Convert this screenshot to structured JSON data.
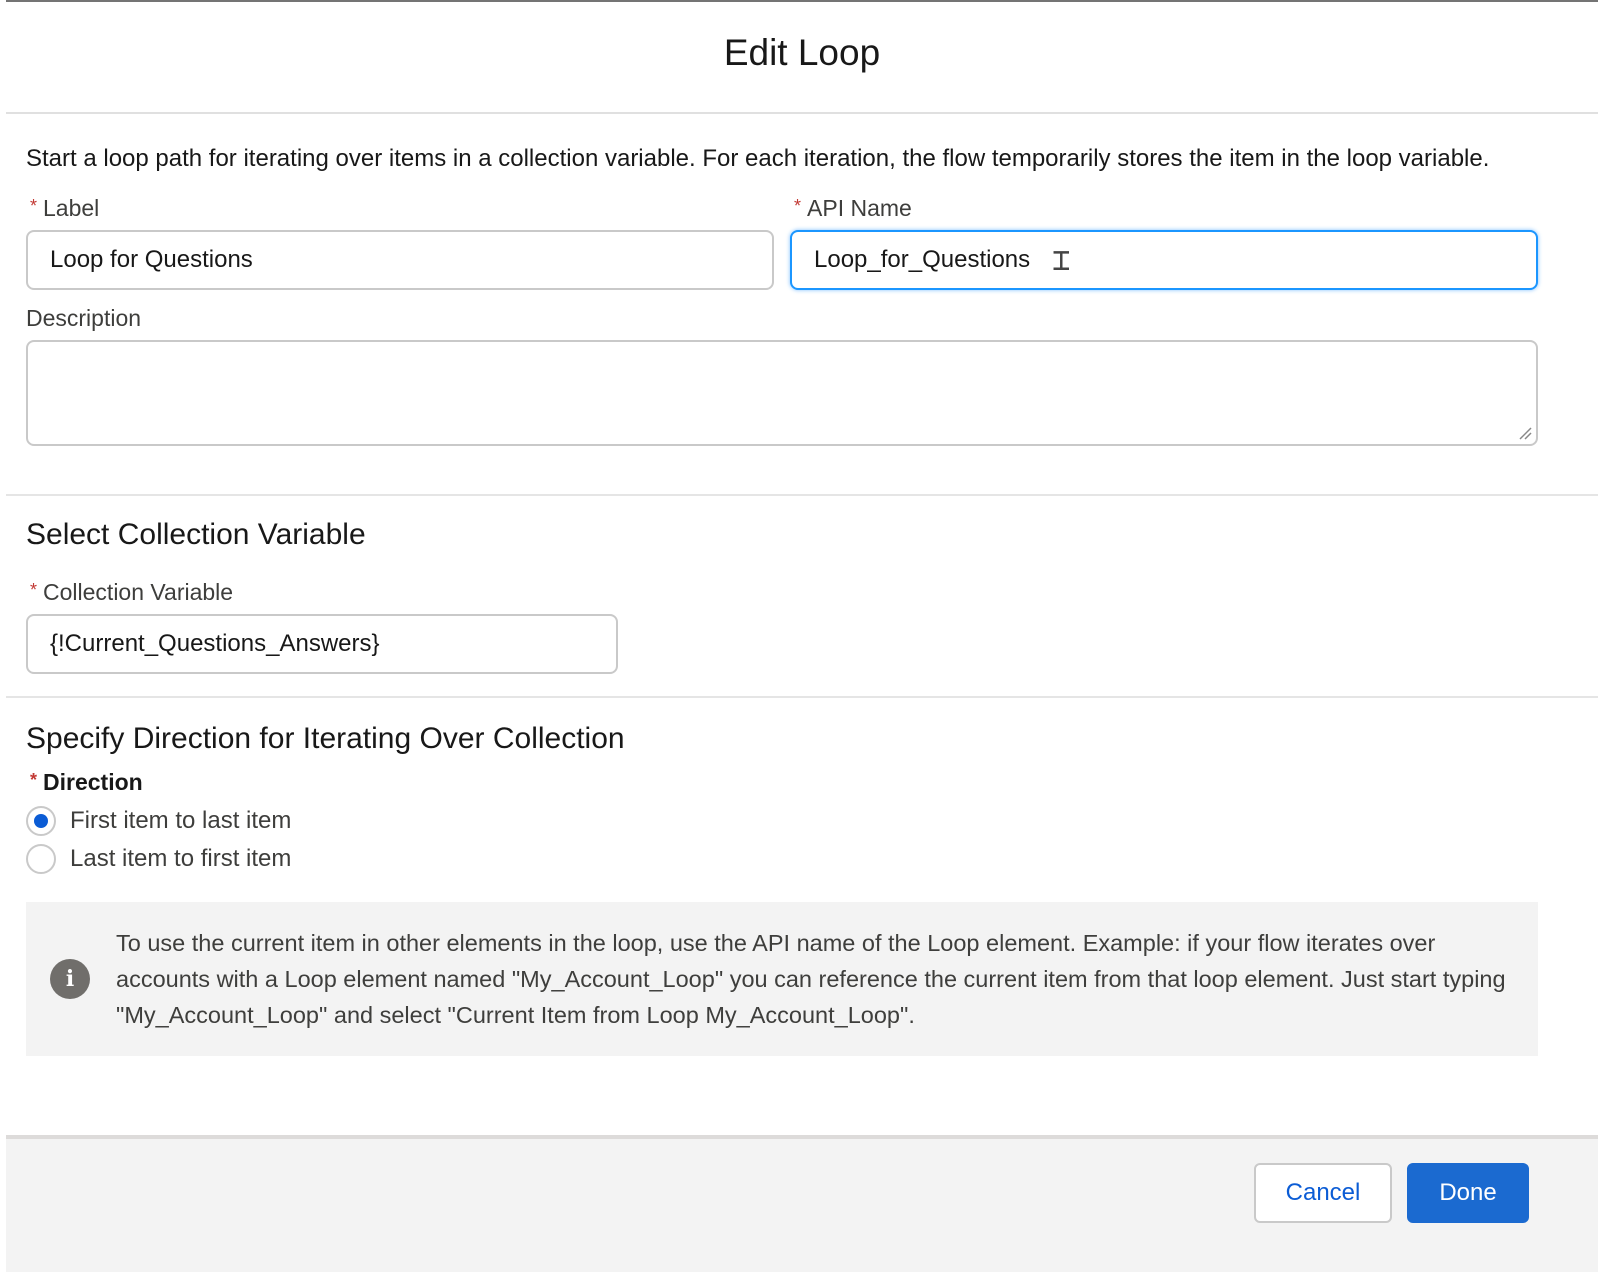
{
  "header": {
    "title": "Edit Loop"
  },
  "intro": "Start a loop path for iterating over items in a collection variable. For each iteration, the flow temporarily stores the item in the loop variable.",
  "fields": {
    "label": {
      "label": "Label",
      "required_mark": "*",
      "value": "Loop for Questions"
    },
    "api_name": {
      "label": "API Name",
      "required_mark": "*",
      "value": "Loop_for_Questions"
    },
    "description": {
      "label": "Description",
      "value": ""
    }
  },
  "collection_section": {
    "title": "Select Collection Variable",
    "field_label": "Collection Variable",
    "required_mark": "*",
    "value": "{!Current_Questions_Answers}"
  },
  "direction_section": {
    "title": "Specify Direction for Iterating Over Collection",
    "field_label": "Direction",
    "required_mark": "*",
    "options": [
      {
        "label": "First item to last item",
        "selected": true
      },
      {
        "label": "Last item to first item",
        "selected": false
      }
    ]
  },
  "info": {
    "icon": "info-icon",
    "icon_glyph": "i",
    "text": "To use the current item in other elements in the loop, use the API name of the Loop element. Example: if your flow iterates over accounts with a Loop element named \"My_Account_Loop\" you can reference the current item from that loop element. Just start typing \"My_Account_Loop\" and select \"Current Item from Loop My_Account_Loop\"."
  },
  "footer": {
    "cancel_label": "Cancel",
    "done_label": "Done"
  },
  "colors": {
    "brand_blue": "#1b6ad0",
    "focus_border": "#1b96ff",
    "required_red": "#c23934",
    "radio_selected": "#0b5cd5"
  }
}
